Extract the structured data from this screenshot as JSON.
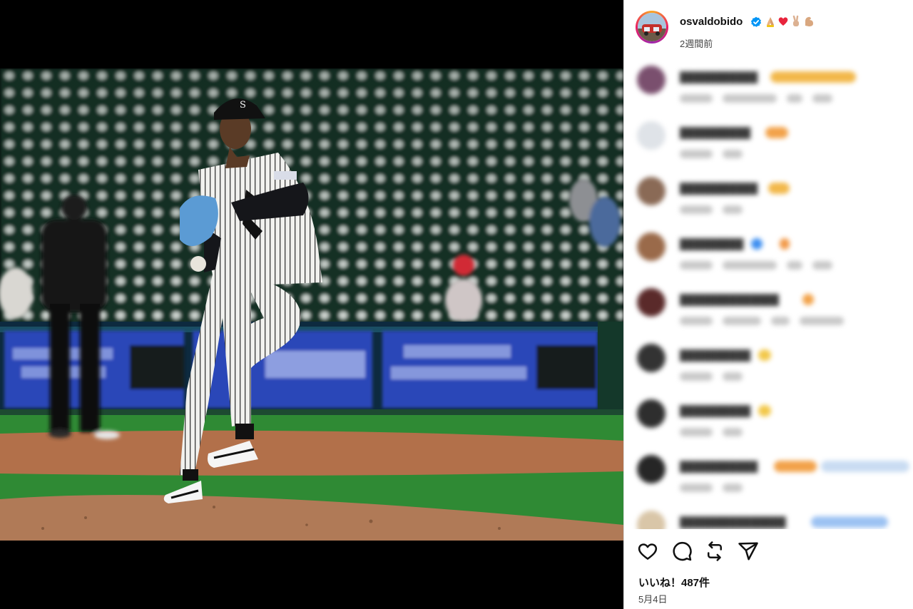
{
  "post": {
    "username": "osvaldobido",
    "verified": true,
    "header_emojis": [
      "folded-hands-emoji",
      "red-heart-emoji",
      "victory-hand-emoji",
      "flexed-biceps-emoji"
    ],
    "time_ago": "2週間前",
    "likes_text": "いいね！487件",
    "date": "5月4日"
  },
  "actions": [
    {
      "name": "like-button",
      "icon": "heart-icon"
    },
    {
      "name": "comment-button",
      "icon": "comment-icon"
    },
    {
      "name": "repost-button",
      "icon": "repost-icon"
    },
    {
      "name": "share-button",
      "icon": "send-icon"
    }
  ],
  "colors": {
    "panel_bg": "#ffffff",
    "media_bg": "#000000",
    "verified_blue": "#0095f6",
    "text_primary": "#111111",
    "text_secondary": "#444444"
  },
  "photo": {
    "subject": "baseball pitcher in pinstripe uniform mid-windup on mound",
    "ad_board_text": "Big Sox Fan? We're Here For It"
  }
}
